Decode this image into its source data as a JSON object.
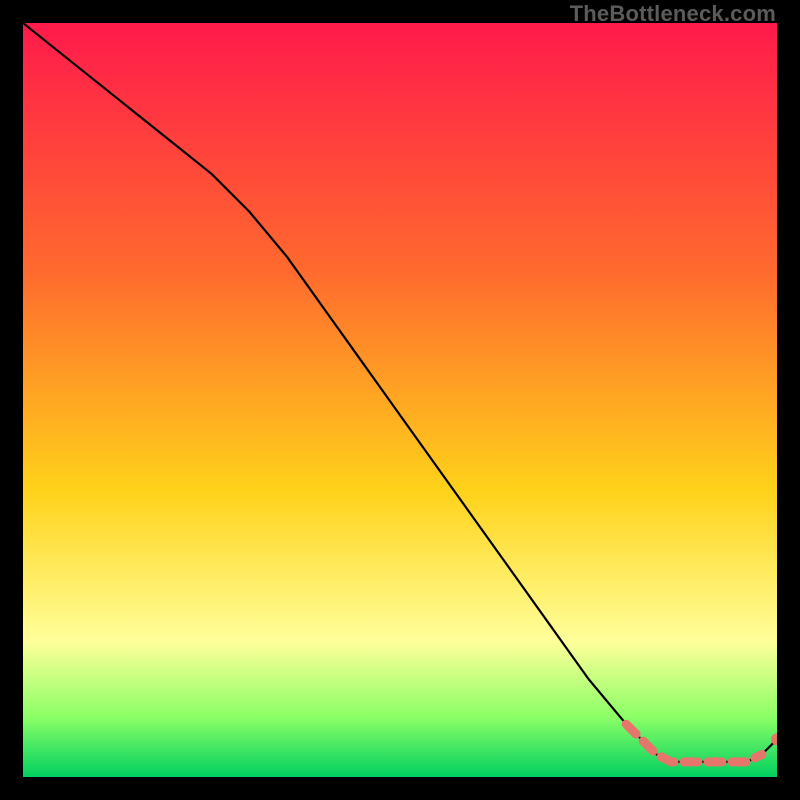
{
  "watermark": "TheBottleneck.com",
  "colors": {
    "top": "#ff1a4b",
    "mid1": "#ff6a2e",
    "mid2": "#ffd21a",
    "band": "#ffff9a",
    "green1": "#8cff66",
    "green2": "#00d060",
    "line": "#000000",
    "dot": "#e6766b"
  },
  "gradient_stops": [
    {
      "offset": 0.0,
      "key": "top"
    },
    {
      "offset": 0.33,
      "key": "mid1"
    },
    {
      "offset": 0.62,
      "key": "mid2"
    },
    {
      "offset": 0.82,
      "key": "band"
    },
    {
      "offset": 0.92,
      "key": "green1"
    },
    {
      "offset": 1.0,
      "key": "green2"
    }
  ],
  "chart_data": {
    "type": "line",
    "title": "",
    "xlabel": "",
    "ylabel": "",
    "xlim": [
      0,
      100
    ],
    "ylim": [
      0,
      100
    ],
    "x": [
      0,
      5,
      10,
      15,
      20,
      25,
      30,
      35,
      40,
      45,
      50,
      55,
      60,
      65,
      70,
      75,
      80,
      82,
      84,
      86,
      88,
      90,
      92,
      94,
      96,
      98,
      100
    ],
    "values": [
      100,
      96,
      92,
      88,
      84,
      80,
      75,
      69,
      62,
      55,
      48,
      41,
      34,
      27,
      20,
      13,
      7,
      5,
      3,
      2,
      2,
      2,
      2,
      2,
      2,
      3,
      5
    ],
    "highlight": {
      "note": "thick dashed segment near the bottom",
      "x": [
        80,
        82,
        84,
        86,
        88,
        90,
        92,
        94,
        96,
        98
      ],
      "values": [
        7,
        5,
        3,
        2,
        2,
        2,
        2,
        2,
        2,
        3
      ]
    },
    "end_dot": {
      "x": 100,
      "y": 5
    }
  }
}
